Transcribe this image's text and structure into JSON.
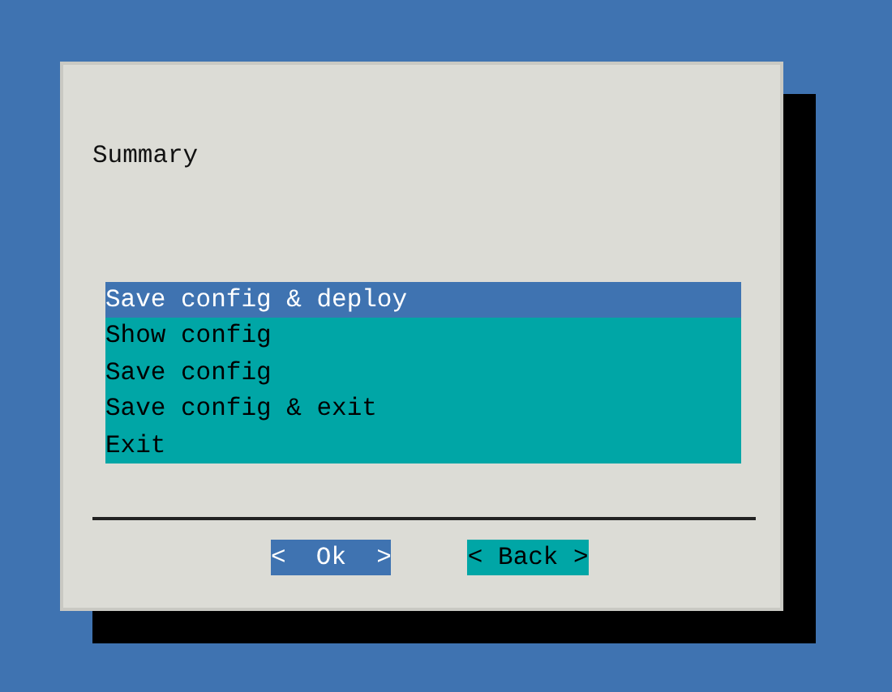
{
  "dialog": {
    "message": "Summary",
    "menu": [
      {
        "label": "Save config & deploy",
        "selected": true
      },
      {
        "label": "Show config",
        "selected": false
      },
      {
        "label": "Save config",
        "selected": false
      },
      {
        "label": "Save config & exit",
        "selected": false
      },
      {
        "label": "Exit",
        "selected": false
      }
    ],
    "buttons": [
      {
        "label": "<  Ok  >",
        "selected": true
      },
      {
        "label": "< Back >",
        "selected": false
      }
    ]
  }
}
